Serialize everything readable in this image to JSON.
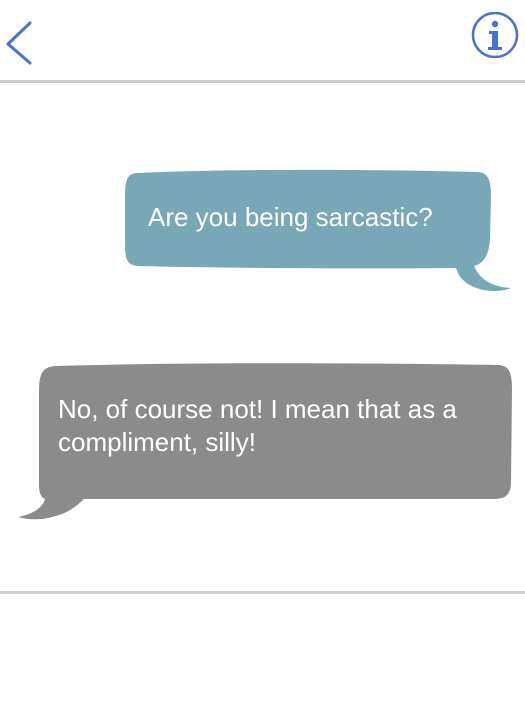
{
  "header": {
    "back_icon": "chevron-left-icon",
    "info_icon": "info-circle-icon",
    "accent_color": "#4a72c8"
  },
  "conversation": {
    "messages": [
      {
        "direction": "sent",
        "text": "Are you being sarcastic?",
        "bubble_color": "#78a8b8"
      },
      {
        "direction": "received",
        "text": "No, of course not! I mean that as a compliment, silly!",
        "bubble_color": "#8b8b8b"
      }
    ]
  }
}
